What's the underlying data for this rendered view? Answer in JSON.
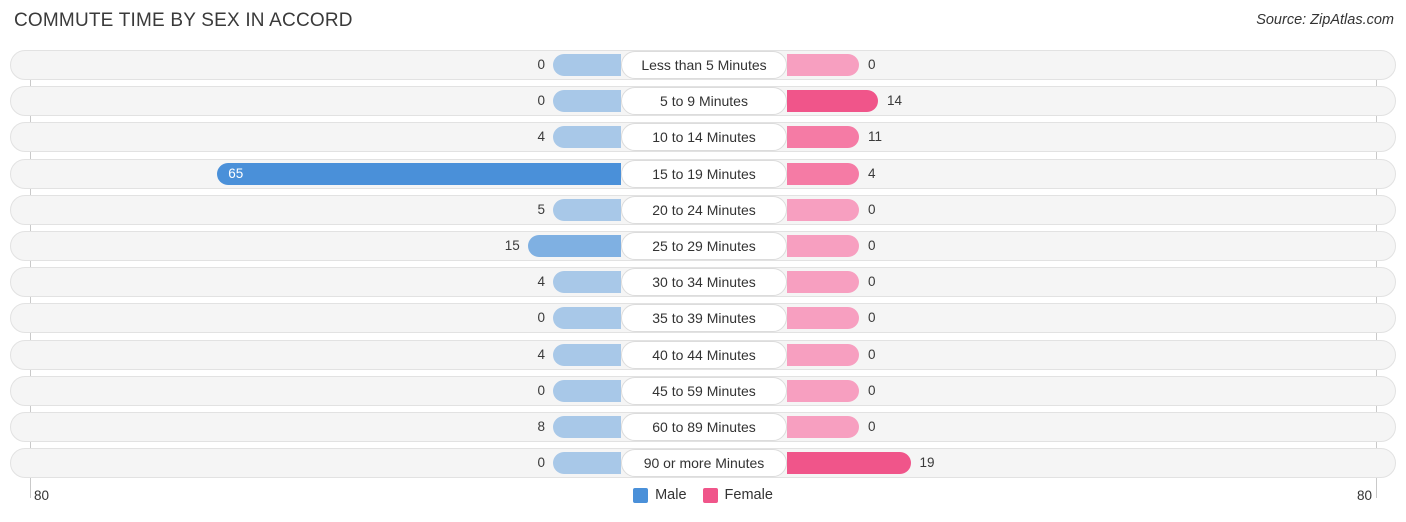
{
  "header": {
    "title": "COMMUTE TIME BY SEX IN ACCORD",
    "source": "Source: ZipAtlas.com"
  },
  "axis": {
    "left_label": "80",
    "right_label": "80"
  },
  "legend": {
    "items": [
      {
        "label": "Male",
        "color": "#4a90d9",
        "swatch_name": "legend-swatch-male"
      },
      {
        "label": "Female",
        "color": "#f0558a",
        "swatch_name": "legend-swatch-female"
      }
    ]
  },
  "chart_data": {
    "type": "bar",
    "subtype": "diverging-butterfly",
    "title": "COMMUTE TIME BY SEX IN ACCORD",
    "xlabel": "",
    "ylabel": "",
    "xlim": [
      80,
      80
    ],
    "grid": false,
    "legend_position": "bottom-center",
    "categories": [
      "Less than 5 Minutes",
      "5 to 9 Minutes",
      "10 to 14 Minutes",
      "15 to 19 Minutes",
      "20 to 24 Minutes",
      "25 to 29 Minutes",
      "30 to 34 Minutes",
      "35 to 39 Minutes",
      "40 to 44 Minutes",
      "45 to 59 Minutes",
      "60 to 89 Minutes",
      "90 or more Minutes"
    ],
    "series": [
      {
        "name": "Male",
        "side": "left",
        "color": "#4a90d9",
        "values": [
          0,
          0,
          4,
          65,
          5,
          15,
          4,
          0,
          4,
          0,
          8,
          0
        ],
        "labels": [
          "0",
          "0",
          "4",
          "65",
          "5",
          "15",
          "4",
          "0",
          "4",
          "0",
          "8",
          "0"
        ]
      },
      {
        "name": "Female",
        "side": "right",
        "color": "#f0558a",
        "values": [
          0,
          14,
          11,
          4,
          0,
          0,
          0,
          0,
          0,
          0,
          0,
          19
        ],
        "labels": [
          "0",
          "14",
          "11",
          "4",
          "0",
          "0",
          "0",
          "0",
          "0",
          "0",
          "0",
          "19"
        ]
      }
    ]
  }
}
